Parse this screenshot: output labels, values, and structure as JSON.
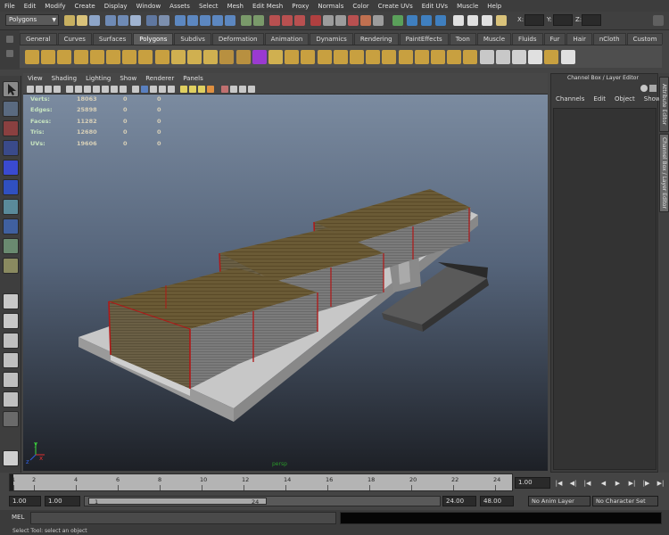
{
  "menubar": {
    "items": [
      "File",
      "Edit",
      "Modify",
      "Create",
      "Display",
      "Window",
      "Assets",
      "Select",
      "Mesh",
      "Edit Mesh",
      "Proxy",
      "Normals",
      "Color",
      "Create UVs",
      "Edit UVs",
      "Muscle",
      "Help"
    ]
  },
  "statusline": {
    "mode": "Polygons",
    "x_label": "X:",
    "y_label": "Y:",
    "z_label": "Z:"
  },
  "shelf": {
    "tabs": [
      "General",
      "Curves",
      "Surfaces",
      "Polygons",
      "Subdivs",
      "Deformation",
      "Animation",
      "Dynamics",
      "Rendering",
      "PaintEffects",
      "Toon",
      "Muscle",
      "Fluids",
      "Fur",
      "Hair",
      "nCloth",
      "Custom"
    ],
    "active_tab": "Polygons"
  },
  "panel": {
    "menu": [
      "View",
      "Shading",
      "Lighting",
      "Show",
      "Renderer",
      "Panels"
    ]
  },
  "hud": {
    "rows": [
      {
        "label": "Verts:",
        "v1": "18063",
        "v2": "0",
        "v3": "0"
      },
      {
        "label": "Edges:",
        "v1": "25898",
        "v2": "0",
        "v3": "0"
      },
      {
        "label": "Faces:",
        "v1": "11282",
        "v2": "0",
        "v3": "0"
      },
      {
        "label": "Tris:",
        "v1": "12680",
        "v2": "0",
        "v3": "0"
      },
      {
        "label": "UVs:",
        "v1": "19606",
        "v2": "0",
        "v3": "0"
      }
    ],
    "camera": "persp",
    "axis_x": "x",
    "axis_y": "y",
    "axis_z": "z"
  },
  "channelbox": {
    "title": "Channel Box / Layer Editor",
    "menu": [
      "Channels",
      "Edit",
      "Object",
      "Show"
    ],
    "side_tabs": [
      "Attribute Editor",
      "Channel Box / Layer Editor"
    ]
  },
  "timeline": {
    "ticks": [
      "1",
      "2",
      "4",
      "6",
      "8",
      "10",
      "12",
      "14",
      "16",
      "18",
      "20",
      "22",
      "24"
    ],
    "current_time": "1.00"
  },
  "range": {
    "start_time": "1.00",
    "playback_start": "1.00",
    "range_start": "1",
    "range_end": "24",
    "playback_end": "24.00",
    "end_time": "48.00",
    "anim_layer": "No Anim Layer",
    "character_set": "No Character Set"
  },
  "cmdline": {
    "label": "MEL",
    "help": "Select Tool: select an object"
  },
  "colors": {
    "accent": "#5e5e5e",
    "building_roof": "#6a5a35",
    "building_frame": "#b01818"
  }
}
